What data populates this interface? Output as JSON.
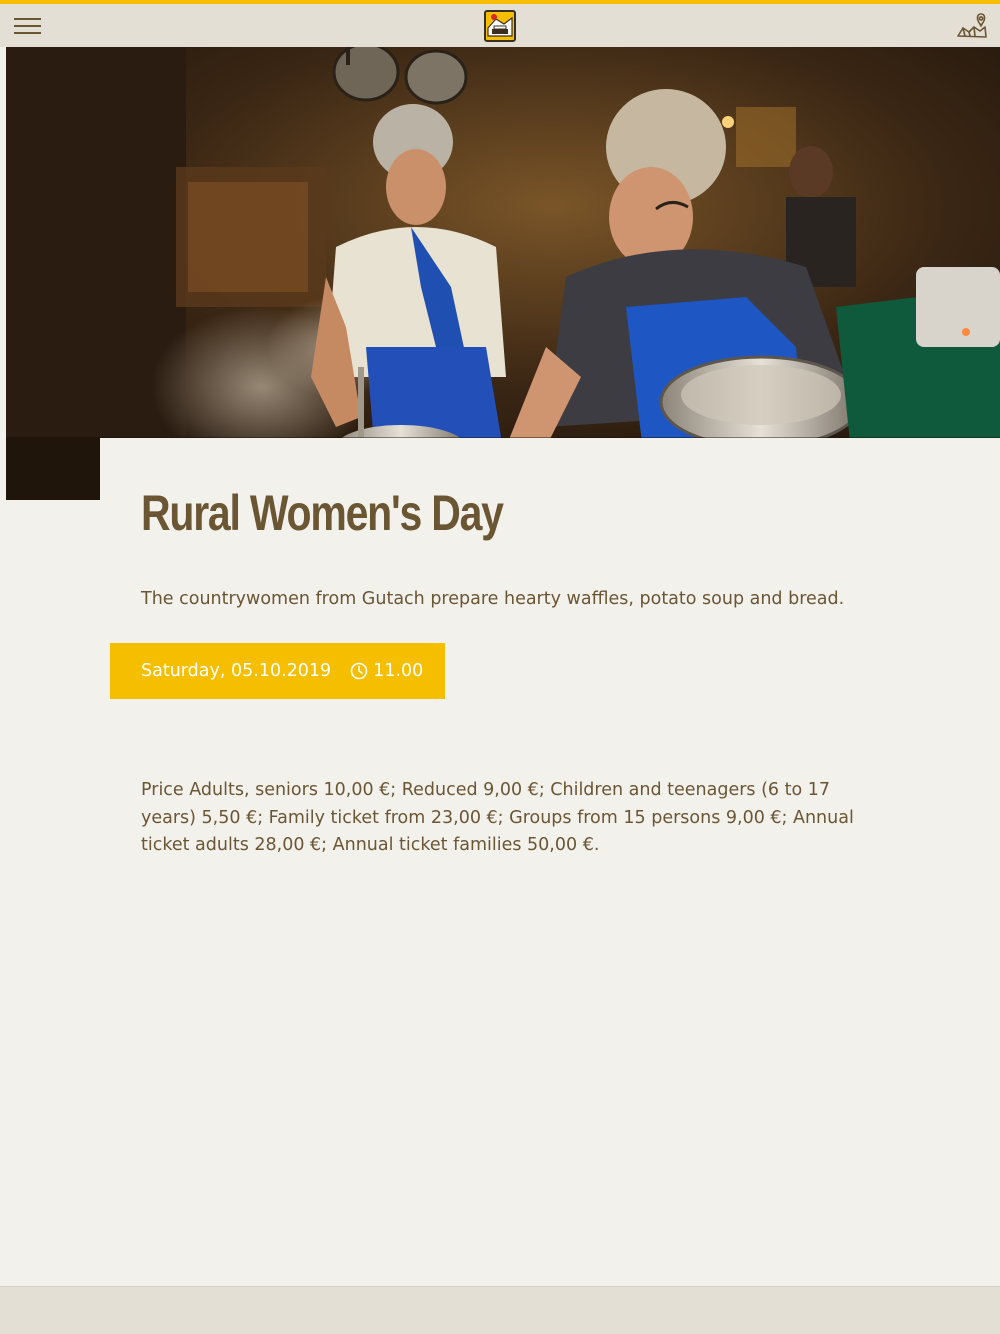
{
  "header": {
    "menu_icon": "hamburger-menu-icon",
    "logo_icon": "site-logo",
    "map_icon": "map-pin-icon"
  },
  "hero": {
    "image": "photo of two women cooking at an open hearth"
  },
  "event": {
    "title": "Rural Women's Day",
    "description": "The countrywomen from Gutach prepare hearty waffles, potato soup and bread.",
    "date": "Saturday, 05.10.2019",
    "time_icon": "clock-icon",
    "time": "11.00",
    "price_info": "Price Adults, seniors 10,00 €; Reduced 9,00 €; Children and teenagers (6 to 17 years) 5,50 €; Family ticket from 23,00 €; Groups from 15 persons 9,00 €; Annual ticket adults 28,00 €; Annual ticket families 50,00 €."
  },
  "colors": {
    "accent": "#f5bf00",
    "text": "#6b5634",
    "background": "#f3f1ec",
    "header_bg": "#e4dfd5"
  }
}
